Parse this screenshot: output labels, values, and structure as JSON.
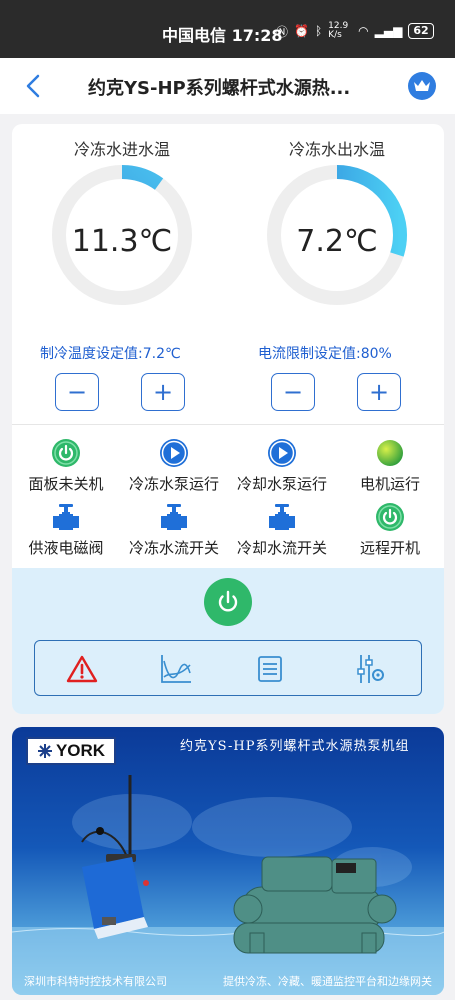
{
  "statusbar": {
    "carrier_time": "中国电信 17:28",
    "net_speed": "12.9 K/s",
    "battery": "62"
  },
  "nav": {
    "title": "约克YS-HP系列螺杆式水源热..."
  },
  "gauges": [
    {
      "label": "冷冻水进水温",
      "value": "11.3℃",
      "fill": 0.1
    },
    {
      "label": "冷冻水出水温",
      "value": "7.2℃",
      "fill": 0.3
    }
  ],
  "settings": [
    {
      "label": "制冷温度设定值:7.2℃",
      "minus": "−",
      "plus": "+"
    },
    {
      "label": "电流限制设定值:80%",
      "minus": "−",
      "plus": "+"
    }
  ],
  "statuses": [
    {
      "label": "面板未关机",
      "icon": "power-icon"
    },
    {
      "label": "冷冻水泵运行",
      "icon": "pump-play-icon"
    },
    {
      "label": "冷却水泵运行",
      "icon": "pump-play-icon"
    },
    {
      "label": "电机运行",
      "icon": "motor-dot-icon"
    },
    {
      "label": "供液电磁阀",
      "icon": "valve-icon"
    },
    {
      "label": "冷冻水流开关",
      "icon": "valve-icon"
    },
    {
      "label": "冷却水流开关",
      "icon": "valve-icon"
    },
    {
      "label": "远程开机",
      "icon": "power-icon"
    }
  ],
  "toolbar": [
    "alarm-icon",
    "trend-chart-icon",
    "list-icon",
    "settings-sliders-icon"
  ],
  "banner": {
    "logo": "YORK",
    "title": "约克YS-HP系列螺杆式水源热泵机组",
    "footer_left": "深圳市科特时控技术有限公司",
    "footer_right": "提供冷冻、冷藏、暖通监控平台和边缘网关"
  },
  "colors": {
    "accent": "#2f7de0",
    "power_green": "#2fb86a",
    "panel_bg": "#dceffb"
  }
}
